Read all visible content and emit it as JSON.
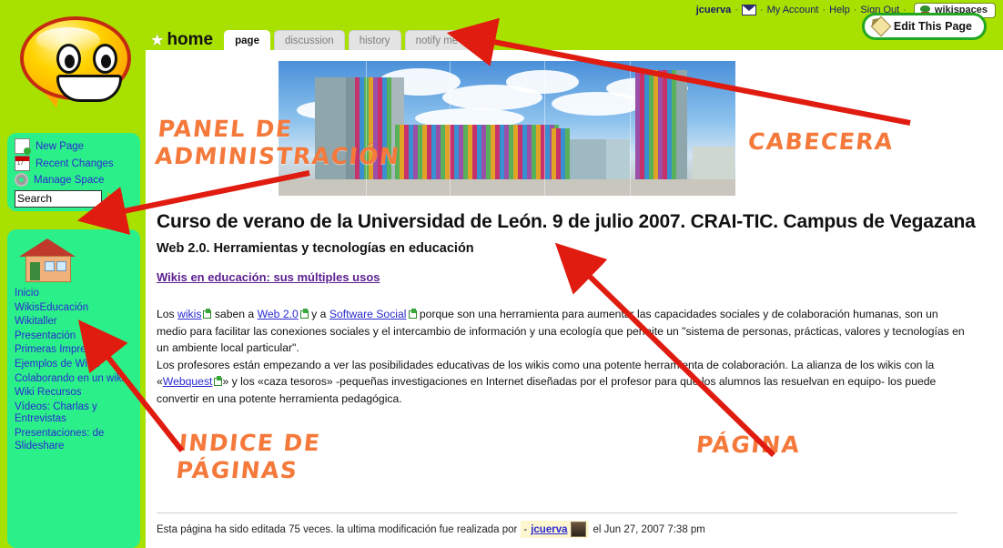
{
  "topbar": {
    "username": "jcuerva",
    "mail_icon": "envelope-icon",
    "links": [
      "My Account",
      "Help",
      "Sign Out"
    ],
    "brand_label": "wikispaces",
    "separator": "·"
  },
  "logo": {
    "name": "smiley-speech-bubble-logo"
  },
  "admin_panel": {
    "items": [
      {
        "label": "New Page",
        "icon": "new-page-icon"
      },
      {
        "label": "Recent Changes",
        "icon": "calendar-icon"
      },
      {
        "label": "Manage Space",
        "icon": "gear-icon"
      }
    ],
    "search_value": "Search",
    "search_placeholder": "Search",
    "go_icon": "green-arrow-icon"
  },
  "index_panel": {
    "home_icon": "house-icon",
    "items": [
      "Inicio",
      "WikisEducación",
      "Wikitaller",
      "Presentación",
      "Primeras Impresiones",
      "Ejemplos de Wikis",
      "Colaborando en un wiki",
      "Wiki Recursos",
      "Vídeos: Charlas y Entrevistas",
      "Presentaciones: de Slideshare"
    ]
  },
  "page_header": {
    "star_icon": "star-icon",
    "page_name": "home",
    "tabs": [
      {
        "label": "page",
        "active": true
      },
      {
        "label": "discussion",
        "active": false
      },
      {
        "label": "history",
        "active": false
      },
      {
        "label": "notify me",
        "active": false
      }
    ],
    "edit_button": "Edit This Page",
    "edit_icon": "pencil-icon"
  },
  "banner": {
    "name": "musac-building-panorama-banner"
  },
  "main": {
    "title": "Curso de verano de la Universidad de León. 9 de julio 2007. CRAI-TIC. Campus de Vegazana",
    "subtitle": "Web 2.0. Herramientas y tecnologías en educación",
    "section_link": "Wikis en educación: sus múltiples usos",
    "paragraph1": {
      "p1_a": "Los ",
      "link1": "wikis",
      "p1_b": " saben a ",
      "link2": "Web 2.0",
      "p1_c": " y a ",
      "link3": "Software Social",
      "p1_d": " porque son una herramienta para aumentar las capacidades sociales y de colaboración humanas, son un medio para facilitar las conexiones sociales y el intercambio de información y una ecología que permite un \"sistema de personas, prácticas, valores y tecnologías en un ambiente local particular\"."
    },
    "paragraph2": {
      "p2_a": "Los profesores están empezando a ver las posibilidades educativas de los wikis como una potente herramienta de colaboración. La alianza de los wikis con la «",
      "link4": "Webquest",
      "p2_b": "» y los «caza tesoros» -pequeñas investigaciones en Internet diseñadas por el profesor para que los alumnos las resuelvan en equipo- los puede convertir en una potente herramienta pedagógica."
    }
  },
  "footer": {
    "prefix": "Esta página ha sido editada 75 veces. la ultima modificación fue realizada por",
    "dash": "-",
    "user": "jcuerva",
    "avatar_icon": "user-avatar",
    "suffix": "el Jun 27, 2007 7:38 pm"
  },
  "annotations": {
    "admin": "PANEL DE\nADMINISTRACIÓN",
    "header": "CABECERA",
    "index": "INDICE DE\nPÁGINAS",
    "page": "PÁGINA",
    "color": "#f4793b",
    "arrow_color": "#e01b10"
  }
}
